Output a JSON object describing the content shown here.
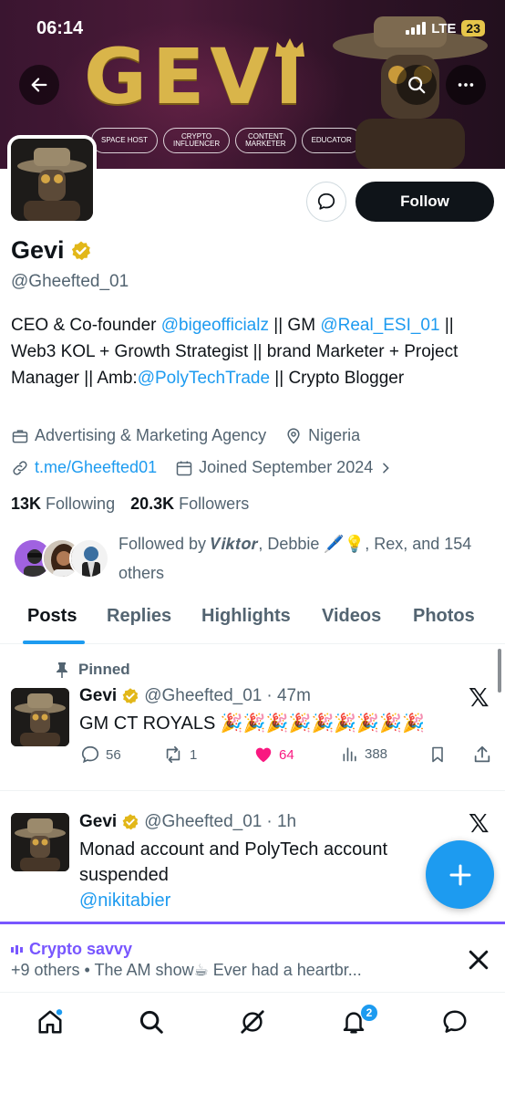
{
  "status_bar": {
    "time": "06:14",
    "network": "LTE",
    "battery": "23"
  },
  "banner": {
    "brand": "GEVI",
    "pills": [
      {
        "line1": "SPACE HOST",
        "line2": ""
      },
      {
        "line1": "CRYPTO",
        "line2": "INFLUENCER"
      },
      {
        "line1": "CONTENT",
        "line2": "MARKETER"
      },
      {
        "line1": "EDUCATOR",
        "line2": ""
      }
    ]
  },
  "profile": {
    "follow_label": "Follow",
    "name": "Gevi",
    "handle": "@Gheefted_01",
    "bio": {
      "p1": "CEO & Co-founder ",
      "m1": "@bigeofficialz",
      "p2": " || GM ",
      "m2": "@Real_ESI_01",
      "p3": " || Web3 KOL + Growth Strategist || brand Marketer + Project Manager || Amb:",
      "m3": "@PolyTechTrade",
      "p4": " || Crypto Blogger"
    },
    "category": "Advertising & Marketing Agency",
    "location": "Nigeria",
    "website": "t.me/Gheefted01",
    "joined": "Joined September 2024",
    "following_count": "13K",
    "following_label": "Following",
    "followers_count": "20.3K",
    "followers_label": "Followers",
    "followed_by": "Followed by 𝑽𝒊𝒌𝒕𝒐𝒓, Debbie 🖊️💡, Rex, and 154 others"
  },
  "tabs": [
    "Posts",
    "Replies",
    "Highlights",
    "Videos",
    "Photos"
  ],
  "posts": [
    {
      "pinned_label": "Pinned",
      "name": "Gevi",
      "handle": "@Gheefted_01",
      "time": "· 47m",
      "text": "GM CT ROYALS 🎉🎉🎉🎉🎉🎉🎉🎉🎉",
      "replies": "56",
      "reposts": "1",
      "likes": "64",
      "views": "388"
    },
    {
      "name": "Gevi",
      "handle": "@Gheefted_01",
      "time": "· 1h",
      "text_line1": "Monad account and PolyTech account",
      "text_line2": "suspended",
      "mention": "@nikitabier"
    }
  ],
  "spaces_bar": {
    "title": "Crypto savvy",
    "subtitle": "+9 others • The AM show☕ Ever had a heartbr..."
  },
  "nav": {
    "notifications_badge": "2"
  },
  "colors": {
    "accent": "#1d9bf0",
    "like": "#f91880",
    "spaces": "#7856ff",
    "verified": "#e2b719"
  }
}
